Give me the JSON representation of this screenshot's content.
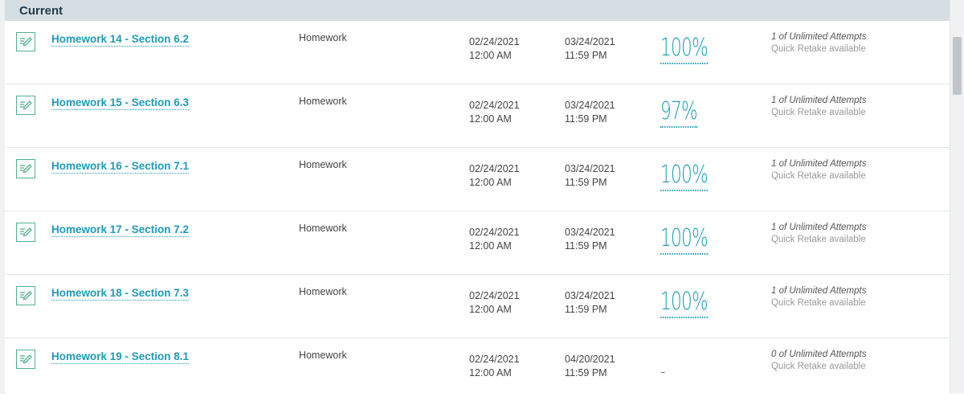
{
  "section": {
    "title": "Current"
  },
  "rows": [
    {
      "title": "Homework 14 - Section 6.2",
      "type": "Homework",
      "start_date": "02/24/2021",
      "start_time": "12:00 AM",
      "due_date": "03/24/2021",
      "due_time": "11:59 PM",
      "score": "100%",
      "attempts": "1 of Unlimited Attempts",
      "retake": "Quick Retake available"
    },
    {
      "title": "Homework 15 - Section 6.3",
      "type": "Homework",
      "start_date": "02/24/2021",
      "start_time": "12:00 AM",
      "due_date": "03/24/2021",
      "due_time": "11:59 PM",
      "score": "97%",
      "attempts": "1 of Unlimited Attempts",
      "retake": "Quick Retake available"
    },
    {
      "title": "Homework 16 - Section 7.1",
      "type": "Homework",
      "start_date": "02/24/2021",
      "start_time": "12:00 AM",
      "due_date": "03/24/2021",
      "due_time": "11:59 PM",
      "score": "100%",
      "attempts": "1 of Unlimited Attempts",
      "retake": "Quick Retake available"
    },
    {
      "title": "Homework 17 - Section 7.2",
      "type": "Homework",
      "start_date": "02/24/2021",
      "start_time": "12:00 AM",
      "due_date": "03/24/2021",
      "due_time": "11:59 PM",
      "score": "100%",
      "attempts": "1 of Unlimited Attempts",
      "retake": "Quick Retake available"
    },
    {
      "title": "Homework 18 - Section 7.3",
      "type": "Homework",
      "start_date": "02/24/2021",
      "start_time": "12:00 AM",
      "due_date": "03/24/2021",
      "due_time": "11:59 PM",
      "score": "100%",
      "attempts": "1 of Unlimited Attempts",
      "retake": "Quick Retake available"
    },
    {
      "title": "Homework 19 - Section 8.1",
      "type": "Homework",
      "start_date": "02/24/2021",
      "start_time": "12:00 AM",
      "due_date": "04/20/2021",
      "due_time": "11:59 PM",
      "score": "-",
      "attempts": "0 of Unlimited Attempts",
      "retake": "Quick Retake available"
    }
  ],
  "icons": {
    "assignment": "homework-assignment-icon"
  },
  "colors": {
    "header_bg": "#d5dee2",
    "link": "#1f9bb8",
    "icon": "#4fb38a"
  }
}
